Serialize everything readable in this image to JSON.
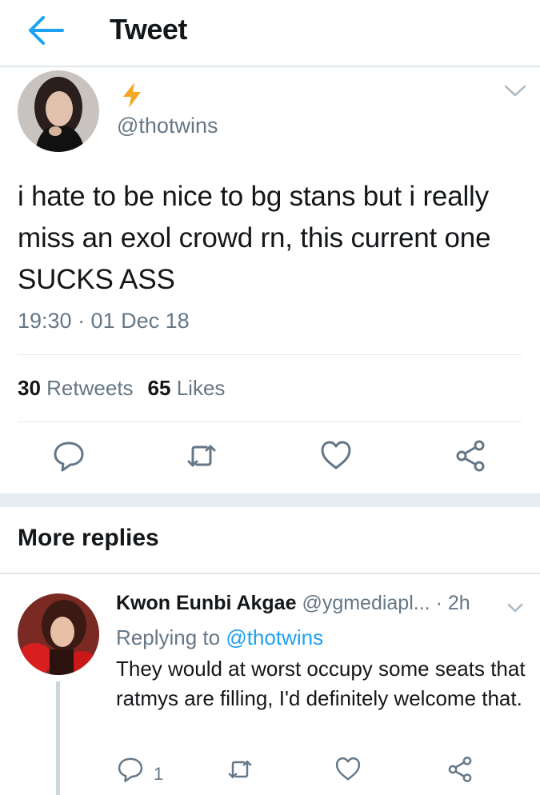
{
  "header": {
    "title": "Tweet",
    "back_icon": "arrow-left-icon",
    "accent_color": "#1da1f2"
  },
  "tweet": {
    "author_name_icon": "lightning-bolt-icon",
    "handle": "@thotwins",
    "text": "i hate to be nice to bg stans but i really miss an exol crowd rn, this current one SUCKS ASS",
    "timestamp": "19:30 · 01 Dec 18",
    "retweets_count": "30",
    "retweets_label": "Retweets",
    "likes_count": "65",
    "likes_label": "Likes",
    "actions": [
      "reply-icon",
      "retweet-icon",
      "like-icon",
      "share-icon"
    ]
  },
  "more_replies": {
    "title": "More replies",
    "reply": {
      "name": "Kwon Eunbi Akgae",
      "handle": "@ygmediapl...",
      "time": "· 2h",
      "replying_prefix": "Replying to",
      "replying_to": "@thotwins",
      "text": "They would at worst occupy some seats that ratmys are filling, I'd definitely welcome that.",
      "reply_count": "1"
    }
  }
}
